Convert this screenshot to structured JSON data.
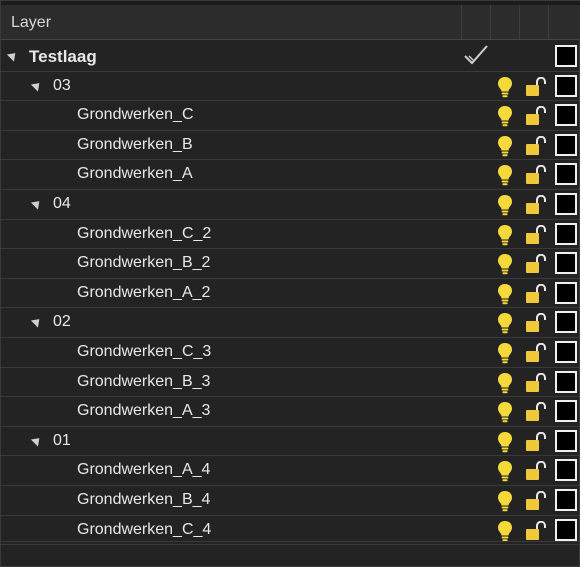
{
  "header": {
    "title": "Layer"
  },
  "tree": [
    {
      "label": "Testlaag",
      "level": 0,
      "expanded": true,
      "visible_icon": "check-icon"
    },
    {
      "label": "03",
      "level": 1,
      "expanded": true
    },
    {
      "label": "Grondwerken_C",
      "level": 2
    },
    {
      "label": "Grondwerken_B",
      "level": 2
    },
    {
      "label": "Grondwerken_A",
      "level": 2
    },
    {
      "label": "04",
      "level": 1,
      "expanded": true
    },
    {
      "label": "Grondwerken_C_2",
      "level": 2
    },
    {
      "label": "Grondwerken_B_2",
      "level": 2
    },
    {
      "label": "Grondwerken_A_2",
      "level": 2
    },
    {
      "label": "02",
      "level": 1,
      "expanded": true
    },
    {
      "label": "Grondwerken_C_3",
      "level": 2
    },
    {
      "label": "Grondwerken_B_3",
      "level": 2
    },
    {
      "label": "Grondwerken_A_3",
      "level": 2
    },
    {
      "label": "01",
      "level": 1,
      "expanded": true
    },
    {
      "label": "Grondwerken_A_4",
      "level": 2
    },
    {
      "label": "Grondwerken_B_4",
      "level": 2
    },
    {
      "label": "Grondwerken_C_4",
      "level": 2
    }
  ],
  "colors": {
    "bulb": "#f5d93a",
    "lock": "#f0c93a",
    "background": "#232323",
    "row_border": "#3a3a3a"
  }
}
